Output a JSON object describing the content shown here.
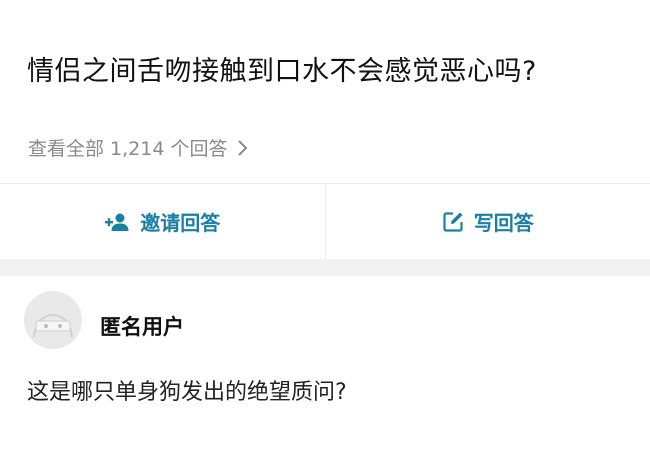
{
  "question": {
    "title": "情侣之间舌吻接触到口水不会感觉恶心吗?",
    "view_all": "查看全部 1,214 个回答"
  },
  "actions": {
    "invite_label": "邀请回答",
    "write_label": "写回答",
    "accent_color": "#1a7fa6"
  },
  "answer": {
    "author": "匿名用户",
    "text": "这是哪只单身狗发出的绝望质问?"
  }
}
